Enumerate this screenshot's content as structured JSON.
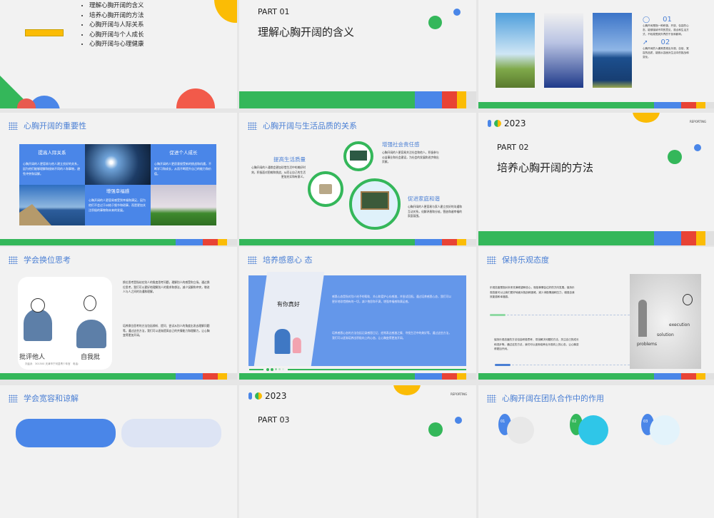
{
  "slides": [
    {
      "toc": [
        "理解心胸开阔的含义",
        "培养心胸开阔的方法",
        "心胸开阔与人际关系",
        "心胸开阔与个人成长",
        "心胸开阔与心理健康"
      ]
    },
    {
      "part": "PART 01",
      "title": "理解心胸开阔的含义"
    },
    {
      "items": [
        {
          "num": "01",
          "text": "心胸开阔是指一种积极、开放、包容的心态，能够接纳不同的意见、观点和生活方式，不轻易受到外界的干扰和影响。"
        },
        {
          "num": "02",
          "text": "心胸开阔的人通常表现出乐观、自信、宽容的品质，能够从容面对生活中的挑战和变化。"
        }
      ]
    },
    {
      "title": "心胸开阔的重要性",
      "boxes": [
        {
          "title": "提高人际关系",
          "text": "心胸开阔的人更容易与他人建立良好的关系，因为他们能够理解和接纳不同的人和事物，避免冲突和误解。"
        },
        {
          "title": "促进个人成长",
          "text": "心胸开阔的人更愿意接受新的挑战和机遇，不断学习和成长，从而不断提升自己的能力和价值。"
        },
        {
          "title": "增强幸福感",
          "text": "心胸开阔的人更容易感受到幸福和满足，因为他们不会过于纠结于细节和琐事，而是更加关注积极的事物和未来的发展。"
        }
      ]
    },
    {
      "title": "心胸开阔与生活品质的关系",
      "items": [
        {
          "title": "提高生活质量",
          "text": "心胸开阔的人通常会更加珍惜生活中的美好时刻，积极面对困难和挑战，从而让自己的生活更加充实和有意义。"
        },
        {
          "title": "增强社会责任感",
          "text": "心胸开阔的人更容易关注社会和他人，积极参与公益事业和社会建设，为社会的发展和进步做出贡献。"
        },
        {
          "title": "促进家庭和谐",
          "text": "心胸开阔的人更容易与家人建立良好的沟通和互动关系，化解矛盾和分歧，营造和谐幸福的家庭氛围。"
        }
      ]
    },
    {
      "year": "2023",
      "reporting": "REPORTING",
      "part": "PART 02",
      "title": "培养心胸开阔的方法"
    },
    {
      "title": "学会换位思考",
      "caption_left": "批评他人",
      "caption_right": "自我批",
      "credit": "刘孟永　301500 天津市宁河县青少年宫　电话:",
      "paras": [
        "换位思考是指站在别人的角度思考问题，理解别人的感受和立场。通过换位思考，我们可以更好地理解别人的需求和想法，减少误解和冲突，增进人与人之间的沟通和理解。",
        "培养换位思考的方法包括倾听、提问、尝试从别人的角度出发去理解问题等。通过这些方法，我们可以逐渐提高自己的共情能力和理解力，让心胸变得更加开阔。"
      ]
    },
    {
      "title": "培养感恩心 态",
      "card_text": "有你真好",
      "paras": [
        "感恩心态是指对别人给予的帮助、关心和爱护心存感激，并尝试回报。通过培养感恩心态，我们可以更好地珍惜拥有的一切，减少抱怨和不满，增强幸福感和满足感。",
        "培养感恩心态的方法包括记录感恩日记、经常表达感激之情、寻找生活中的美好等。通过这些方法，我们可以逐渐培养出积极向上的心态，让心胸变得更加开阔。"
      ]
    },
    {
      "title": "保持乐观态度",
      "diagram_words": [
        "execution",
        "solution",
        "problems"
      ],
      "paras": [
        "乐观态度是指对未来充满希望和信心，相信事情会往好的方向发展。保持乐观态度可以让我们更好地面对挑战和困难，减少消极情绪和压力，增强自我效能感和幸福感。",
        "保持乐观态度的方法包括积极思考、寻找解决问题的方法、关注自己的成长和进步等。通过这些方法，我们可以逐渐培养出乐观向上的心态，让心胸变得更加开阔。"
      ]
    },
    {
      "title": "学会宽容和谅解"
    },
    {
      "year": "2023",
      "reporting": "REPORTING",
      "part": "PART 03"
    },
    {
      "title": "心胸开阔在团队合作中的作用",
      "nums": [
        "01",
        "02",
        "03"
      ]
    }
  ]
}
